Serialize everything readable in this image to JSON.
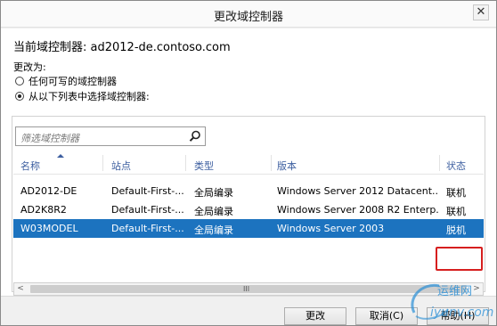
{
  "window": {
    "title": "更改域控制器",
    "close_glyph": "✕"
  },
  "current_dc": "当前域控制器: ad2012-de.contoso.com",
  "change_to_label": "更改为:",
  "options": [
    {
      "label": "任何可写的域控制器",
      "checked": false
    },
    {
      "label": "从以下列表中选择域控制器:",
      "checked": true
    }
  ],
  "search": {
    "placeholder": "筛选域控制器",
    "icon": "search-icon"
  },
  "table": {
    "columns": [
      "名称",
      "站点",
      "类型",
      "版本",
      "状态"
    ],
    "sorted_column": "名称",
    "rows": [
      {
        "name": "AD2012-DE",
        "site": "Default-First-...",
        "type": "全局编录",
        "version": "Windows Server 2012 Datacent...",
        "status": "联机",
        "selected": false
      },
      {
        "name": "AD2K8R2",
        "site": "Default-First-...",
        "type": "全局编录",
        "version": "Windows Server 2008 R2 Enterp...",
        "status": "联机",
        "selected": false
      },
      {
        "name": "W03MODEL",
        "site": "Default-First-...",
        "type": "全局编录",
        "version": "Windows Server 2003",
        "status": "脱机",
        "selected": true
      }
    ]
  },
  "scrollbar": {
    "left_arrow": "<",
    "right_arrow": ">",
    "grip": "III"
  },
  "buttons": {
    "change": "更改",
    "cancel": "取消(C)",
    "help": "帮助(H)"
  },
  "watermark": {
    "line1": "运维网",
    "line2": "iyunv.com"
  },
  "colors": {
    "selection": "#1c73bf",
    "highlight_box": "#d61f1f",
    "header_text": "#3d5fa0"
  }
}
